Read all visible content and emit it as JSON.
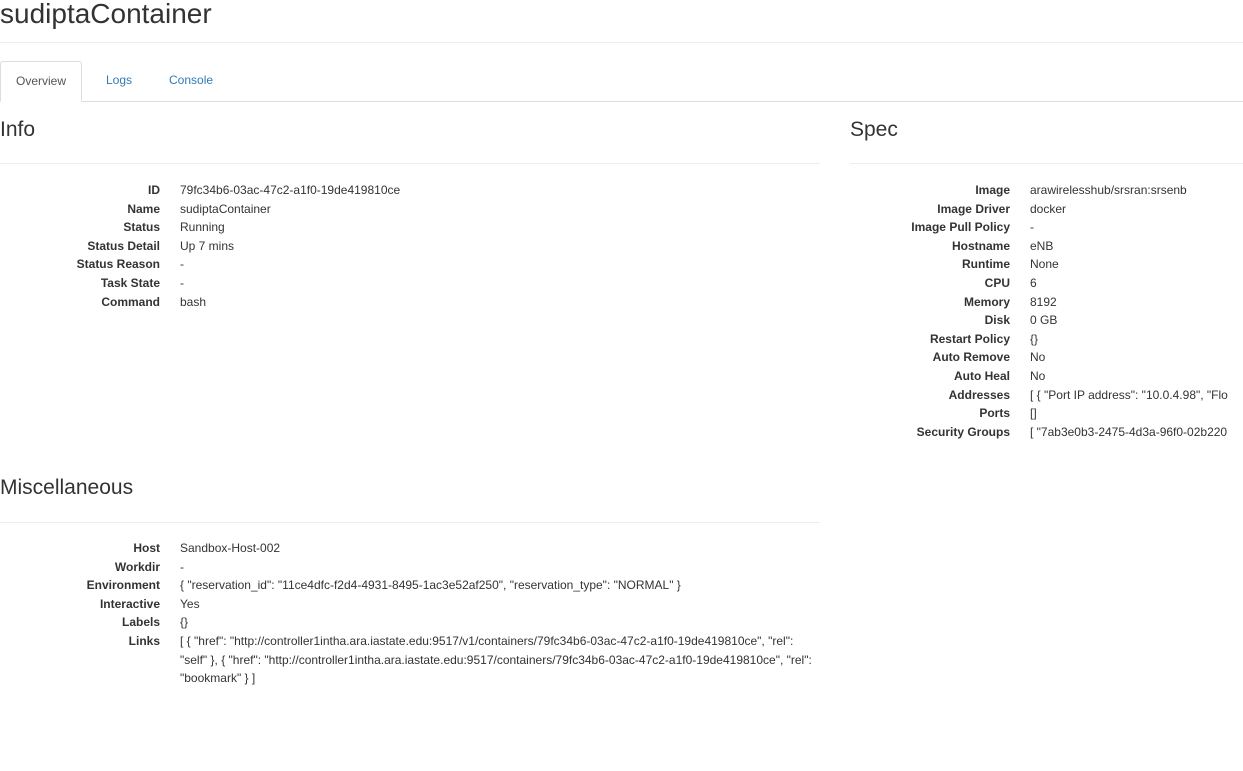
{
  "page": {
    "title": "sudiptaContainer"
  },
  "tabs": [
    {
      "label": "Overview",
      "active": true
    },
    {
      "label": "Logs",
      "active": false
    },
    {
      "label": "Console",
      "active": false
    }
  ],
  "info": {
    "title": "Info",
    "rows": [
      {
        "label": "ID",
        "value": "79fc34b6-03ac-47c2-a1f0-19de419810ce"
      },
      {
        "label": "Name",
        "value": "sudiptaContainer"
      },
      {
        "label": "Status",
        "value": "Running"
      },
      {
        "label": "Status Detail",
        "value": "Up 7 mins"
      },
      {
        "label": "Status Reason",
        "value": "-"
      },
      {
        "label": "Task State",
        "value": "-"
      },
      {
        "label": "Command",
        "value": "bash"
      }
    ]
  },
  "spec": {
    "title": "Spec",
    "rows": [
      {
        "label": "Image",
        "value": "arawirelesshub/srsran:srsenb"
      },
      {
        "label": "Image Driver",
        "value": "docker"
      },
      {
        "label": "Image Pull Policy",
        "value": "-"
      },
      {
        "label": "Hostname",
        "value": "eNB"
      },
      {
        "label": "Runtime",
        "value": "None"
      },
      {
        "label": "CPU",
        "value": "6"
      },
      {
        "label": "Memory",
        "value": "8192"
      },
      {
        "label": "Disk",
        "value": "0 GB"
      },
      {
        "label": "Restart Policy",
        "value": "{}"
      },
      {
        "label": "Auto Remove",
        "value": "No"
      },
      {
        "label": "Auto Heal",
        "value": "No"
      },
      {
        "label": "Addresses",
        "value": "[ { \"Port IP address\": \"10.0.4.98\", \"Flo"
      },
      {
        "label": "Ports",
        "value": "[]"
      },
      {
        "label": "Security Groups",
        "value": "[ \"7ab3e0b3-2475-4d3a-96f0-02b220"
      }
    ]
  },
  "misc": {
    "title": "Miscellaneous",
    "rows": [
      {
        "label": "Host",
        "value": "Sandbox-Host-002"
      },
      {
        "label": "Workdir",
        "value": "-"
      },
      {
        "label": "Environment",
        "value": "{ \"reservation_id\": \"11ce4dfc-f2d4-4931-8495-1ac3e52af250\", \"reservation_type\": \"NORMAL\" }"
      },
      {
        "label": "Interactive",
        "value": "Yes"
      },
      {
        "label": "Labels",
        "value": "{}"
      },
      {
        "label": "Links",
        "value": "[ { \"href\": \"http://controller1intha.ara.iastate.edu:9517/v1/containers/79fc34b6-03ac-47c2-a1f0-19de419810ce\", \"rel\": \"self\" }, { \"href\": \"http://controller1intha.ara.iastate.edu:9517/containers/79fc34b6-03ac-47c2-a1f0-19de419810ce\", \"rel\": \"bookmark\" } ]"
      }
    ]
  }
}
